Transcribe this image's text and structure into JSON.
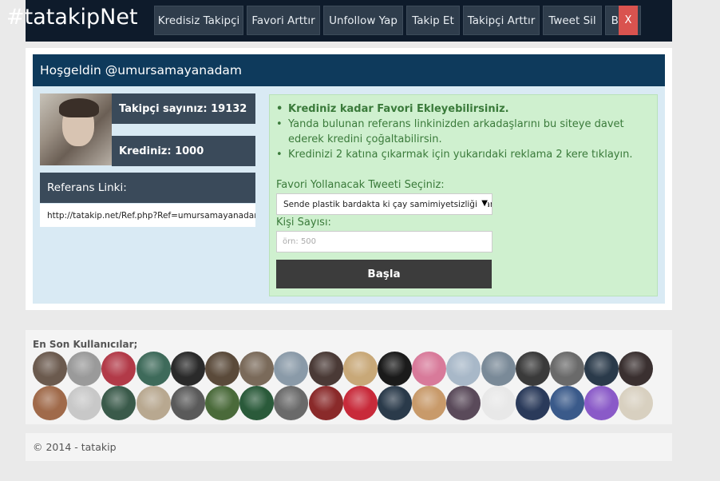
{
  "brand": "#tatakipNet",
  "nav": {
    "items": [
      {
        "label": "Kredisiz Takipçi"
      },
      {
        "label": "Favori Arttır"
      },
      {
        "label": "Unfollow Yap"
      },
      {
        "label": "Takip Et"
      },
      {
        "label": "Takipçi Arttır"
      },
      {
        "label": "Tweet Sil"
      },
      {
        "label": "Blog"
      }
    ],
    "close_label": "X"
  },
  "welcome": "Hoşgeldin @umursamayanadam",
  "stats": {
    "followers": "Takipçi sayınız: 19132",
    "credits": "Krediniz: 1000"
  },
  "referral": {
    "heading": "Referans Linki:",
    "link": "http://tatakip.net/Ref.php?Ref=umursamayanadam"
  },
  "info": [
    "Krediniz kadar Favori Ekleyebilirsiniz.",
    "Yanda bulunan referans linkinizden arkadaşlarını bu siteye davet ederek kredini çoğaltabilirsin.",
    "Kredinizi 2 katına çıkarmak için yukarıdaki reklama 2 kere tıklayın."
  ],
  "form": {
    "tweet_label": "Favori Yollanacak Tweeti Seçiniz:",
    "tweet_selected": "Sende plastik bardakta ki çay samimiyetsizliği var",
    "count_label": "Kişi Sayısı:",
    "count_placeholder": "örn: 500",
    "start_label": "Başla"
  },
  "recent": {
    "title": "En Son Kullanıcılar;",
    "avatar_colors": [
      "#6b5a4e",
      "#9a9a9a",
      "#b23a48",
      "#3e6a5a",
      "#2a2a2a",
      "#5a4a3a",
      "#7a6a5a",
      "#8a9aa8",
      "#4a3a36",
      "#c8a878",
      "#1a1a1a",
      "#d87a9a",
      "#a8b8c8",
      "#7a8a98",
      "#3a3a3a",
      "#6a6a6a",
      "#2a3a4a",
      "#3a3030",
      "#a06a4a",
      "#c8c8c8",
      "#3a5a4a",
      "#b8a890",
      "#5a5a5a",
      "#4a6a3a",
      "#2a5a3a",
      "#6a6a6a",
      "#8a2a2a",
      "#c82a3a",
      "#2a3a4a",
      "#c89a6a",
      "#5a4a5a",
      "#e8e8e8",
      "#2a3a5a",
      "#3a5a8a",
      "#8a5ac8",
      "#d8d0c0"
    ]
  },
  "footer": "© 2014 - tatakip"
}
